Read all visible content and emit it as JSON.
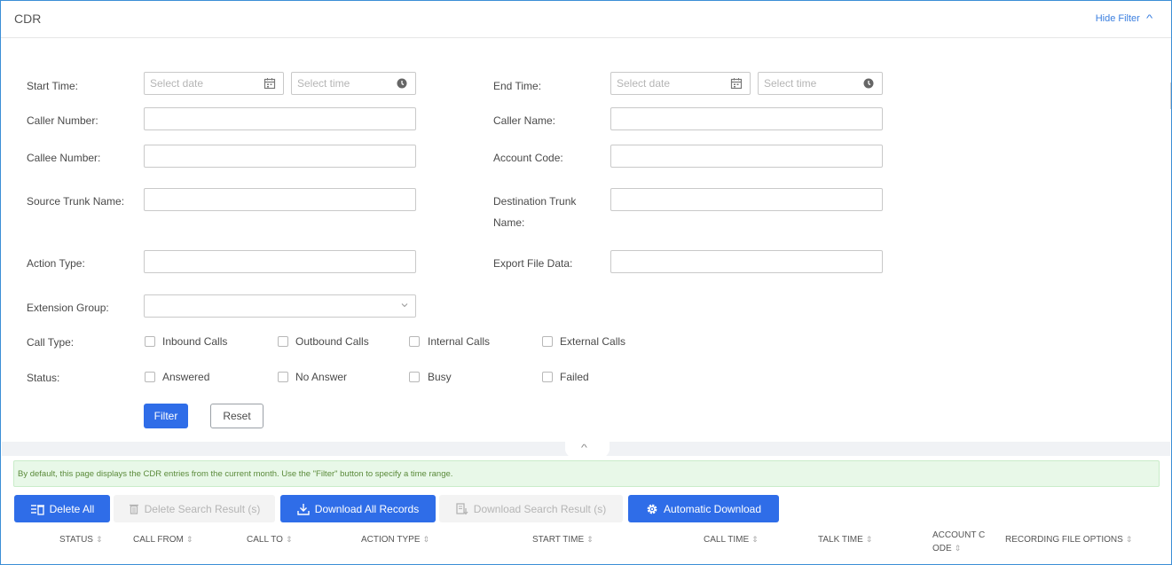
{
  "header": {
    "title": "CDR",
    "hide_filter": "Hide Filter"
  },
  "filter": {
    "start_time_label": "Start Time:",
    "end_time_label": "End Time:",
    "date_placeholder": "Select date",
    "time_placeholder": "Select time",
    "caller_number_label": "Caller Number:",
    "caller_name_label": "Caller Name:",
    "callee_number_label": "Callee Number:",
    "account_code_label": "Account Code:",
    "source_trunk_label": "Source Trunk Name:",
    "dest_trunk_label": "Destination Trunk Name:",
    "action_type_label": "Action Type:",
    "export_file_label": "Export File Data:",
    "extension_group_label": "Extension Group:",
    "call_type_label": "Call Type:",
    "call_types": [
      "Inbound Calls",
      "Outbound Calls",
      "Internal Calls",
      "External Calls"
    ],
    "status_label": "Status:",
    "statuses": [
      "Answered",
      "No Answer",
      "Busy",
      "Failed"
    ],
    "filter_btn": "Filter",
    "reset_btn": "Reset"
  },
  "info": "By default, this page displays the CDR entries from the current month. Use the \"Filter\" button to specify a time range.",
  "toolbar": {
    "delete_all": "Delete All",
    "delete_search": "Delete Search Result (s)",
    "download_all": "Download All Records",
    "download_search": "Download Search Result (s)",
    "auto_download": "Automatic Download"
  },
  "table": {
    "columns": [
      "STATUS",
      "CALL FROM",
      "CALL TO",
      "ACTION TYPE",
      "START TIME",
      "CALL TIME",
      "TALK TIME",
      "ACCOUNT CODE",
      "RECORDING FILE OPTIONS"
    ],
    "sort_glyph": "⇕"
  },
  "colors": {
    "primary": "#2f6de8",
    "link": "#3b7fe0",
    "info_bg": "#e8f8e8",
    "border": "#3b8ed6"
  },
  "icons": [
    "calendar-icon",
    "clock-icon",
    "chevron-up-icon",
    "chevron-down-icon",
    "delete-all-icon",
    "trash-icon",
    "download-icon",
    "file-download-icon",
    "gear-icon"
  ]
}
